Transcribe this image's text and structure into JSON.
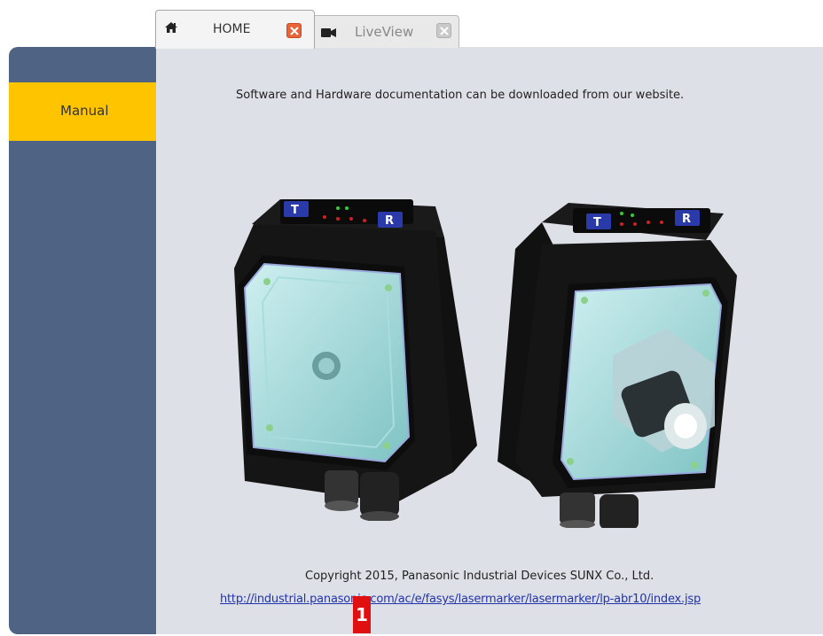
{
  "tabs": [
    {
      "label": "HOME",
      "icon": "home-icon",
      "active": true
    },
    {
      "label": "LiveView",
      "icon": "video-camera-icon",
      "active": false
    }
  ],
  "sidebar": {
    "items": [
      {
        "label": "Manual",
        "active": true
      }
    ]
  },
  "main": {
    "intro_text": "Software and Hardware documentation can be downloaded from our website.",
    "copyright": "Copyright 2015, Panasonic Industrial Devices SUNX Co., Ltd.",
    "link_text": "http://industrial.panasonic.com/ac/e/fasys/lasermarker/lasermarker/lp-abr10/index.jsp"
  },
  "annotation": {
    "marker": "1"
  },
  "colors": {
    "sidebar_bg": "#4f6484",
    "sidebar_active": "#ffc400",
    "content_bg": "#dde0e6",
    "close_active": "#e8653a",
    "link": "#2233aa",
    "marker": "#e11010"
  }
}
